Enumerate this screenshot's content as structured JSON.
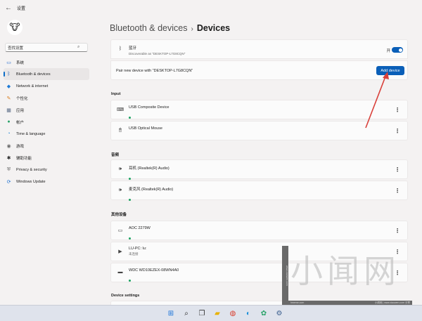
{
  "app": {
    "title": "设置",
    "back_glyph": "←"
  },
  "sidebar": {
    "avatar_glyph": "🐮",
    "search": {
      "value": "查找设置",
      "icon": "search-icon",
      "glyph": "⌕"
    },
    "items": [
      {
        "label": "系统",
        "icon": "monitor-icon",
        "glyph": "▭",
        "color": "#2a6fd1"
      },
      {
        "label": "Bluetooth & devices",
        "icon": "bluetooth-icon",
        "glyph": "ᛒ",
        "color": "#1f5fb0",
        "active": true
      },
      {
        "label": "Network & internet",
        "icon": "wifi-icon",
        "glyph": "◆",
        "color": "#1d7ad6"
      },
      {
        "label": "个性化",
        "icon": "brush-icon",
        "glyph": "✎",
        "color": "#d97c1e"
      },
      {
        "label": "应用",
        "icon": "apps-icon",
        "glyph": "▦",
        "color": "#5a6b86"
      },
      {
        "label": "帐户",
        "icon": "account-icon",
        "glyph": "●",
        "color": "#2aa36a"
      },
      {
        "label": "Time & language",
        "icon": "clock-globe-icon",
        "glyph": "◔",
        "color": "#1b82d6"
      },
      {
        "label": "游戏",
        "icon": "gamepad-icon",
        "glyph": "◉",
        "color": "#6a6a6a"
      },
      {
        "label": "辅助功能",
        "icon": "accessibility-icon",
        "glyph": "✱",
        "color": "#2b2b2b"
      },
      {
        "label": "Privacy & security",
        "icon": "shield-icon",
        "glyph": "⛨",
        "color": "#666666"
      },
      {
        "label": "Windows Update",
        "icon": "update-icon",
        "glyph": "⟳",
        "color": "#1b6fd0"
      }
    ]
  },
  "main": {
    "breadcrumb": {
      "parent": "Bluetooth & devices",
      "separator": "›",
      "current": "Devices"
    },
    "bluetooth": {
      "icon": "bluetooth-icon",
      "glyph": "ᛒ",
      "title": "蓝牙",
      "subtitle": "Discoverable as \"DESKTOP-L7G8CQN\"",
      "toggle_label": "开",
      "toggle_on": true
    },
    "pair": {
      "text": "Pair new device with \"DESKTOP-L7G8CQN\"",
      "button": "Add device"
    },
    "sections": {
      "input": "Input",
      "audio": "音频",
      "other": "其他设备",
      "settings": "Device settings"
    },
    "input_devices": [
      {
        "name": "USB Composite Device",
        "icon": "keyboard-icon",
        "glyph": "⌨",
        "status": true
      },
      {
        "name": "USB Optical Mouse",
        "icon": "mouse-icon",
        "glyph": "🖱",
        "status": false
      }
    ],
    "audio_devices": [
      {
        "name": "耳机 (Realtek(R) Audio)",
        "icon": "speaker-icon",
        "glyph": "🕪",
        "status": true
      },
      {
        "name": "麦克风 (Realtek(R) Audio)",
        "icon": "speaker-icon",
        "glyph": "🕪",
        "status": true
      }
    ],
    "other_devices": [
      {
        "name": "AOC 2279W",
        "icon": "monitor-icon",
        "glyph": "▭",
        "sub": "",
        "status": true
      },
      {
        "name": "LU-PC: lu:",
        "icon": "media-device-icon",
        "glyph": "▶",
        "sub": "未连接",
        "status": false
      },
      {
        "name": "WDC WD10EZEX-08WN4A0",
        "icon": "drive-icon",
        "glyph": "▬",
        "sub": "",
        "status": true
      }
    ],
    "more_glyph": "⋮"
  },
  "watermark": {
    "big_text": "小闻网",
    "side_text": "www.xiaowen.com",
    "bottom_left": "hmeme.com",
    "bottom_right": "小闻网 | www.xiaowen.com 分享"
  },
  "taskbar": {
    "icons": [
      {
        "name": "windows-start-icon",
        "glyph": "⊞",
        "color": "#1a73d9"
      },
      {
        "name": "search-icon",
        "glyph": "⌕",
        "color": "#222222"
      },
      {
        "name": "task-view-icon",
        "glyph": "❐",
        "color": "#333333"
      },
      {
        "name": "file-explorer-icon",
        "glyph": "▰",
        "color": "#e8b200"
      },
      {
        "name": "chrome-icon",
        "glyph": "◍",
        "color": "#d93b2b"
      },
      {
        "name": "edge-icon",
        "glyph": "◐",
        "color": "#1a8fd9"
      },
      {
        "name": "app-icon",
        "glyph": "✿",
        "color": "#2aa36a"
      },
      {
        "name": "settings-gear-icon",
        "glyph": "⚙",
        "color": "#3b5f8f"
      }
    ]
  },
  "colors": {
    "accent": "#0a5fb8",
    "status_green": "#1aa260",
    "annotation": "#d9403a"
  }
}
